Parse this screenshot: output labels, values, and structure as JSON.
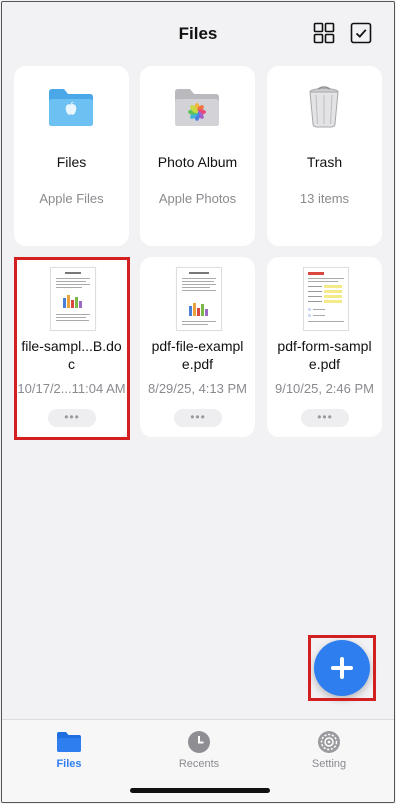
{
  "header": {
    "title": "Files",
    "grid_icon": "grid-view-icon",
    "select_icon": "checkbox-select-icon"
  },
  "folders": [
    {
      "name": "Files",
      "subtitle": "Apple Files",
      "icon": "blue-folder-apple-icon"
    },
    {
      "name": "Photo Album",
      "subtitle": "Apple Photos",
      "icon": "photos-folder-icon"
    },
    {
      "name": "Trash",
      "subtitle": "13 items",
      "icon": "trash-bin-icon"
    }
  ],
  "files": [
    {
      "name": "file-sampl...B.doc",
      "date": "10/17/2...11:04 AM",
      "more": "•••"
    },
    {
      "name": "pdf-file-example.pdf",
      "date": "8/29/25, 4:13 PM",
      "more": "•••"
    },
    {
      "name": "pdf-form-sample.pdf",
      "date": "9/10/25, 2:46 PM",
      "more": "•••"
    }
  ],
  "tabbar": {
    "items": [
      {
        "label": "Files",
        "icon": "folder-icon",
        "active": true
      },
      {
        "label": "Recents",
        "icon": "clock-icon",
        "active": false
      },
      {
        "label": "Setting",
        "icon": "gear-icon",
        "active": false
      }
    ]
  },
  "colors": {
    "accent": "#2f7ef0",
    "highlight": "#d21f1f",
    "background": "#f2f2f4"
  }
}
